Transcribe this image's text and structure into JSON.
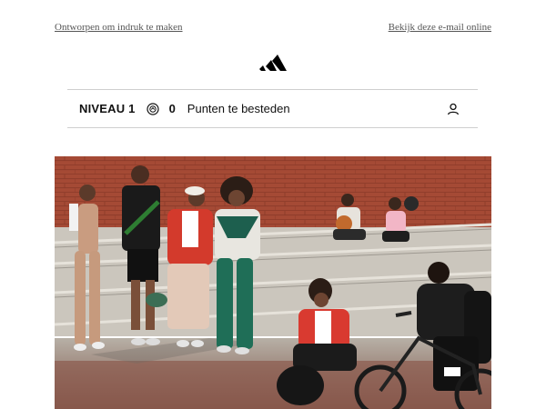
{
  "header": {
    "designed_link": "Ontworpen om indruk te maken",
    "view_online_link": "Bekijk deze e-mail online"
  },
  "brand": {
    "logo_icon": "adidas-logo-icon"
  },
  "loyalty_bar": {
    "level": "NIVEAU 1",
    "points": "0",
    "points_label": "Punten te besteden",
    "coin_icon": "points-coin-icon",
    "account_icon": "user-account-icon"
  },
  "hero_image": {
    "icon": "lifestyle-photo",
    "colors": {
      "wall": "#a54a35",
      "steps": "#c9c4bb",
      "ground": "#8c5a4d"
    }
  }
}
